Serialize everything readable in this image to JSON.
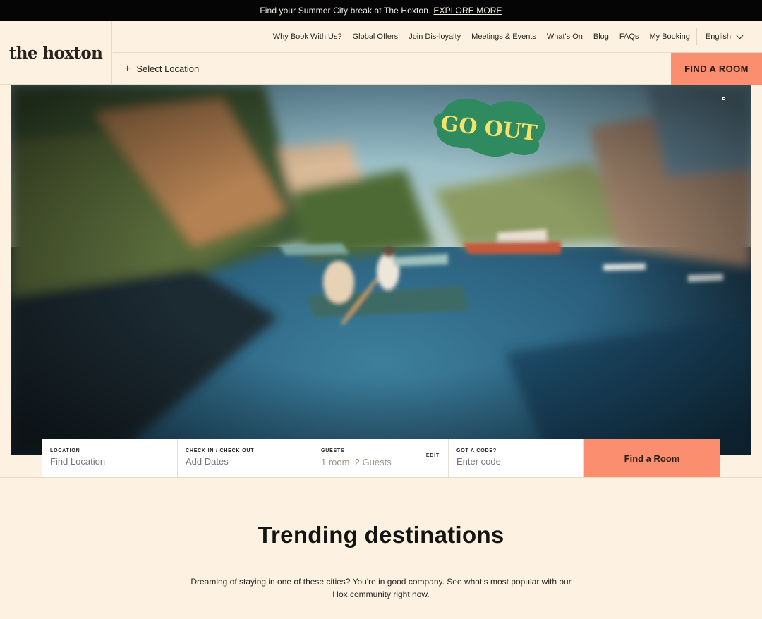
{
  "announcement": {
    "text": "Find your Summer City break at The Hoxton.",
    "link": "EXPLORE MORE"
  },
  "brand": {
    "logo_text": "the hoxton"
  },
  "nav": {
    "items": [
      "Why Book With Us?",
      "Global Offers",
      "Join Dis-loyalty",
      "Meetings & Events",
      "What's On",
      "Blog",
      "FAQs",
      "My Booking"
    ],
    "language": "English"
  },
  "subnav": {
    "select_location": "Select Location",
    "find_room": "FIND A ROOM"
  },
  "hero": {
    "sticker_text": "GO OUT",
    "sticker_color": "#2f8a5f",
    "sticker_text_color": "#f4e36a"
  },
  "booking": {
    "location": {
      "label": "LOCATION",
      "placeholder": "Find Location"
    },
    "dates": {
      "label": "CHECK IN / CHECK OUT",
      "placeholder": "Add Dates"
    },
    "guests": {
      "label": "GUESTS",
      "value": "1 room, 2 Guests",
      "edit": "EDIT"
    },
    "code": {
      "label": "GOT A CODE?",
      "placeholder": "Enter code"
    },
    "button": "Find a Room"
  },
  "trending": {
    "title": "Trending destinations",
    "description": "Dreaming of staying in one of these cities? You're in good company. See what's most popular with our Hox community right now."
  },
  "colors": {
    "background": "#fdf2e2",
    "accent": "#fb8e6e",
    "topbar": "#050505"
  }
}
